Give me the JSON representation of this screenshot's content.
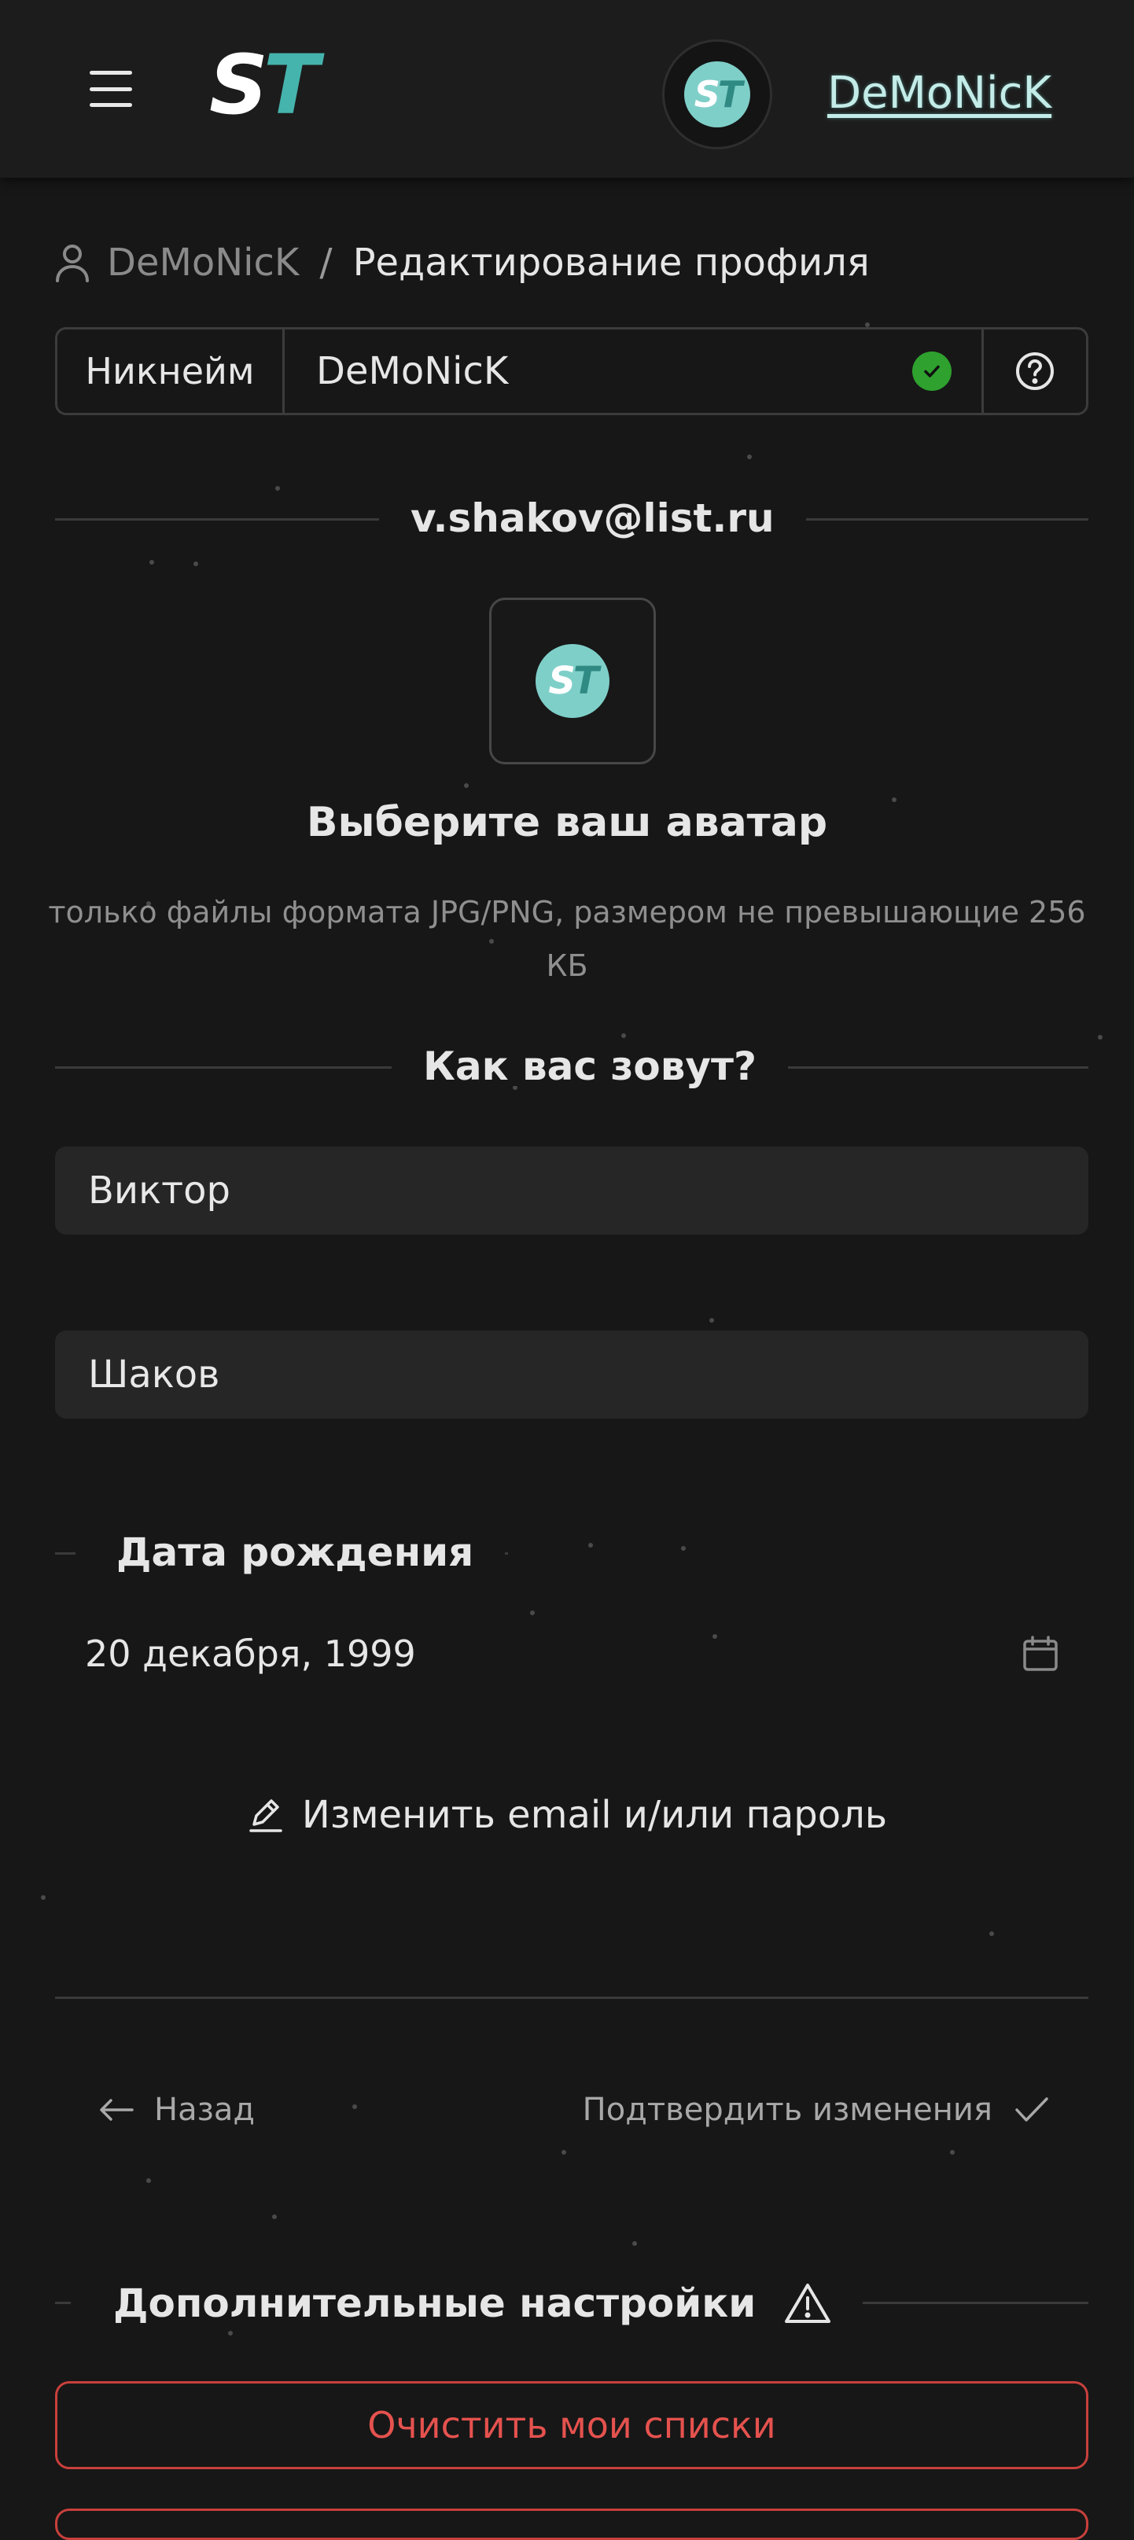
{
  "header": {
    "menu_icon": "hamburger-icon",
    "logo": {
      "s": "S",
      "t": "T"
    },
    "avatar_initials": {
      "s": "S",
      "t": "T"
    },
    "username": "DeMoNicK"
  },
  "breadcrumb": {
    "icon": "user-icon",
    "user": "DeMoNicK",
    "separator": "/",
    "current": "Редактирование профиля"
  },
  "nickname": {
    "label": "Никнейм",
    "value": "DeMoNicK",
    "status_icon": "check-circle-icon",
    "help_icon": "question-circle-icon"
  },
  "email": "v.shakov@list.ru",
  "avatar": {
    "title": "Выберите ваш аватар",
    "hint": "только файлы формата JPG/PNG, размером не превышающие 256 КБ"
  },
  "name_section": {
    "title": "Как вас зовут?",
    "first_name": "Виктор",
    "last_name": "Шаков"
  },
  "birthday": {
    "title": "Дата рождения",
    "value": "20 декабря, 1999",
    "icon": "calendar-icon"
  },
  "change_credentials": {
    "label": "Изменить email и/или пароль",
    "icon": "pencil-icon"
  },
  "actions": {
    "back": "Назад",
    "confirm": "Подтвердить изменения"
  },
  "extra": {
    "title": "Дополнительные настройки",
    "icon": "warning-icon",
    "clear_lists": "Очистить мои списки"
  },
  "colors": {
    "accent": "#45b4ad",
    "danger": "#e5524e",
    "success": "#2ea12e",
    "background": "#171717"
  }
}
